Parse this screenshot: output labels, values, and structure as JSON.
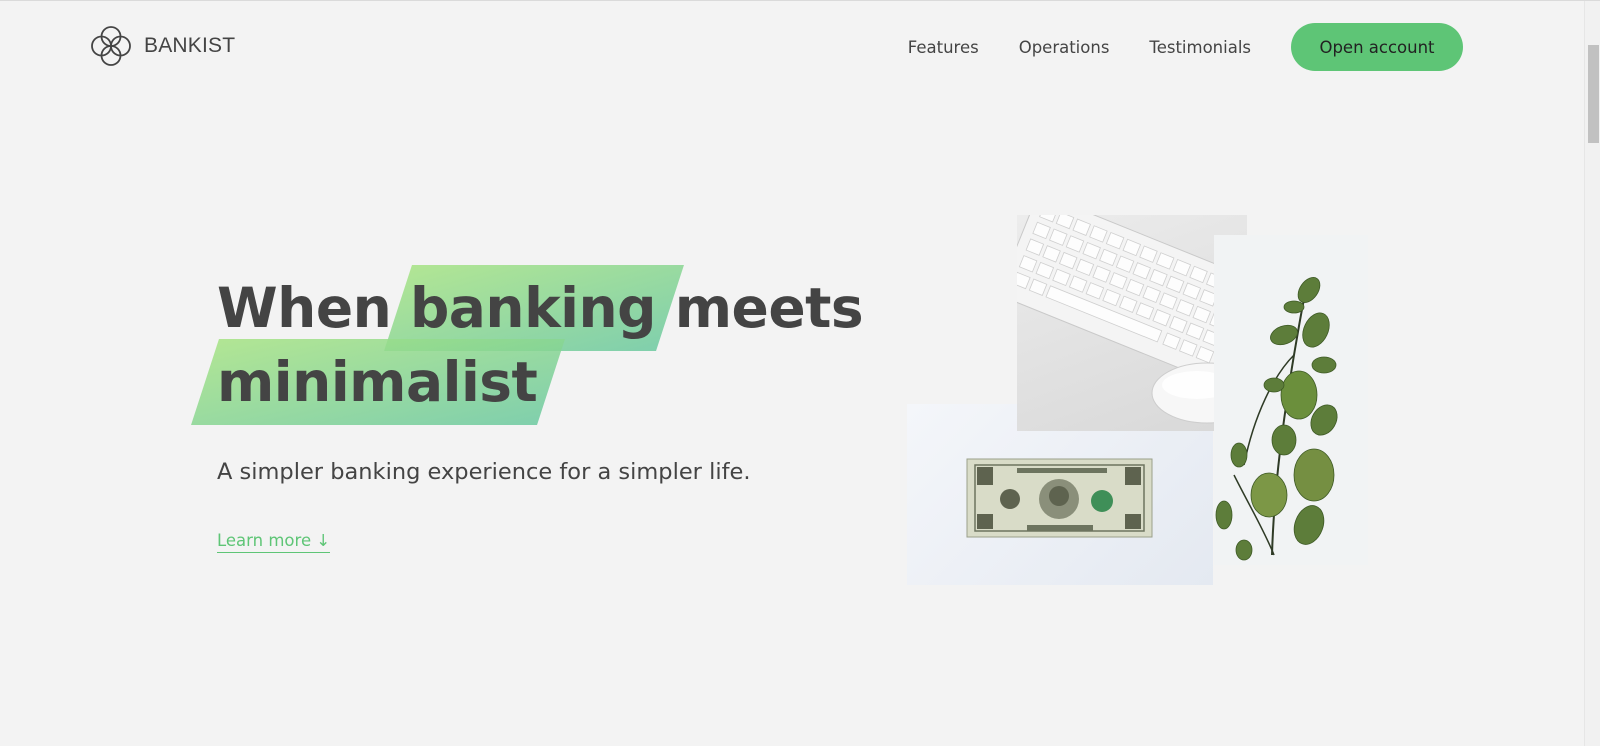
{
  "nav": {
    "brand": "BANKIST",
    "links": [
      {
        "label": "Features"
      },
      {
        "label": "Operations"
      },
      {
        "label": "Testimonials"
      }
    ],
    "cta_label": "Open account"
  },
  "hero": {
    "title_part1": "When",
    "title_highlight1": "banking",
    "title_part2": "meets",
    "title_highlight2": "minimalist",
    "subtitle": "A simpler banking experience for a simpler life.",
    "learn_more": "Learn more ↓"
  },
  "colors": {
    "accent": "#5ec576",
    "highlight_start": "#a6e383",
    "highlight_end": "#6cc9a0",
    "text": "#444444",
    "background": "#f3f3f3"
  },
  "icons": {
    "logo": "interlocking-rings-logo-icon"
  }
}
